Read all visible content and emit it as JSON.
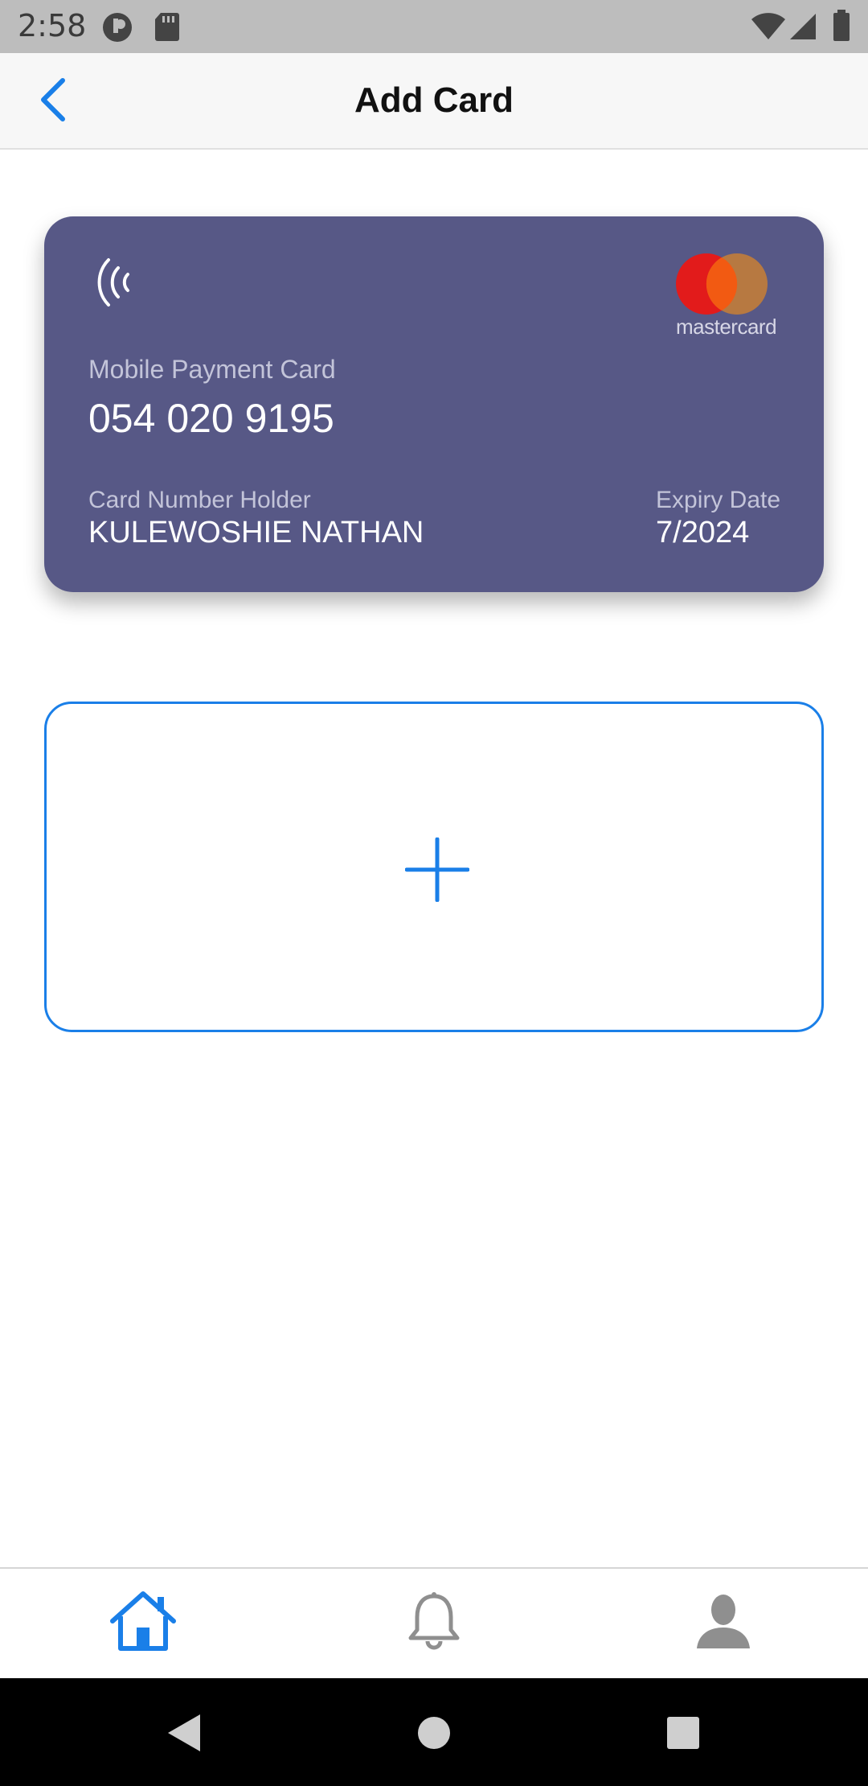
{
  "status_bar": {
    "time": "2:58",
    "left_icons": [
      "app-notification-icon",
      "sd-card-icon"
    ],
    "right_icons": [
      "wifi-icon",
      "cell-signal-icon",
      "battery-icon"
    ]
  },
  "header": {
    "title": "Add Card",
    "back_icon": "chevron-left-icon"
  },
  "card": {
    "brand": "mastercard",
    "type_label": "Mobile Payment Card",
    "number": "054 020 9195",
    "holder_label": "Card Number Holder",
    "holder_name": "KULEWOSHIE NATHAN",
    "expiry_label": "Expiry Date",
    "expiry_date": "7/2024",
    "background_color": "#575886"
  },
  "add_card_button": {
    "icon": "plus-icon",
    "accent_color": "#1a7fe8"
  },
  "bottom_nav": {
    "items": [
      {
        "name": "home",
        "icon": "home-icon",
        "active": true
      },
      {
        "name": "notifications",
        "icon": "bell-icon",
        "active": false
      },
      {
        "name": "profile",
        "icon": "user-icon",
        "active": false
      }
    ]
  },
  "system_nav": {
    "buttons": [
      "back-triangle-icon",
      "home-circle-icon",
      "recents-square-icon"
    ]
  }
}
